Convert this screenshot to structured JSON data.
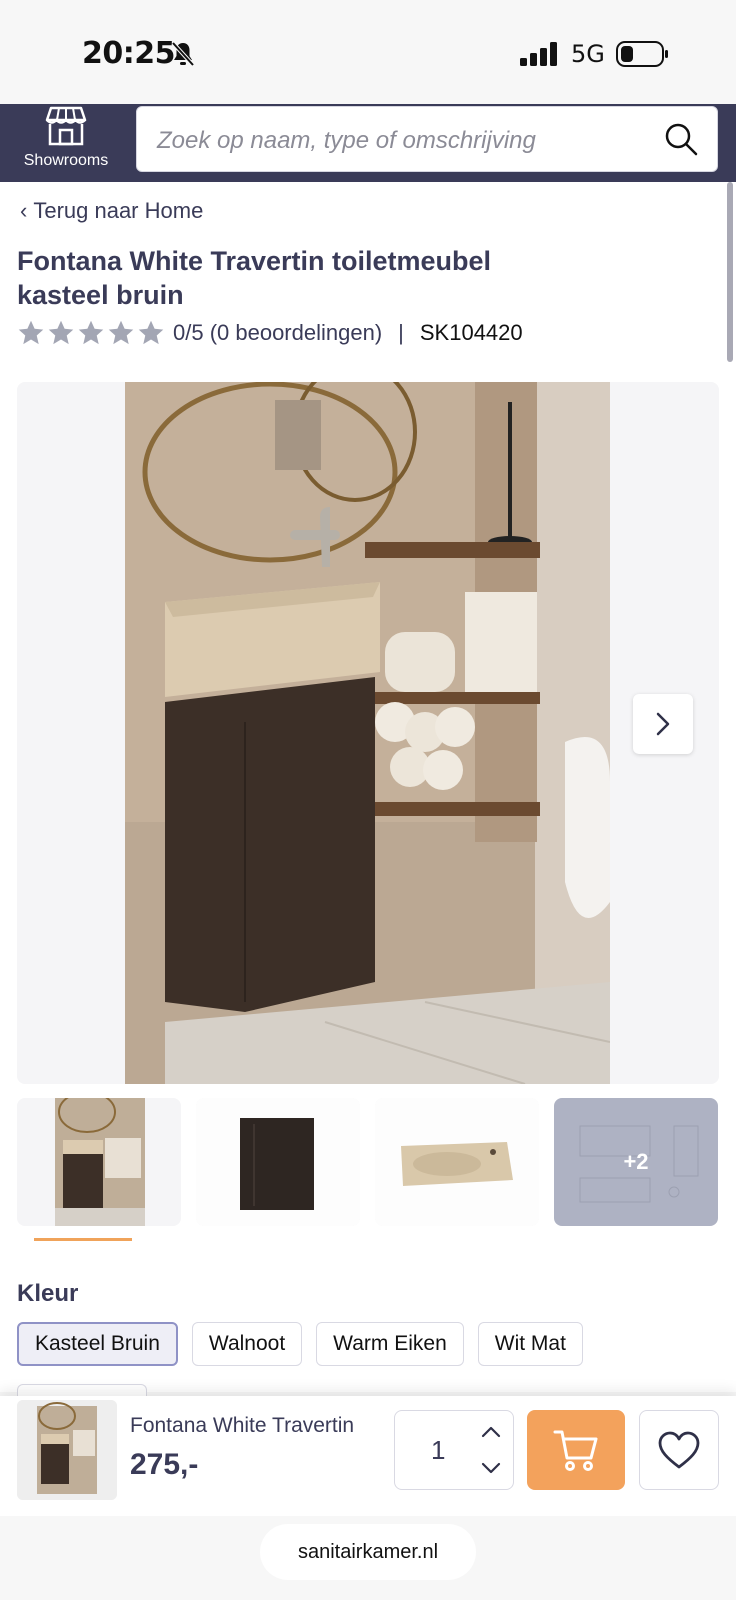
{
  "status_bar": {
    "time": "20:25",
    "network": "5G"
  },
  "header": {
    "showrooms_label": "Showrooms",
    "search_placeholder": "Zoek op naam, type of omschrijving"
  },
  "breadcrumb": {
    "back_label": "Terug naar Home"
  },
  "product": {
    "title": "Fontana White Travertin toiletmeubel kasteel bruin",
    "rating": 0,
    "rating_max": 5,
    "rating_text": "0/5 (0 beoordelingen)",
    "separator": "|",
    "sku": "SK104420"
  },
  "gallery": {
    "thumbnails": [
      "main-photo",
      "cabinet",
      "washbasin",
      "technical-drawing"
    ],
    "more_count_label": "+2"
  },
  "color": {
    "heading": "Kleur",
    "options": [
      "Kasteel Bruin",
      "Walnoot",
      "Warm Eiken",
      "Wit Mat"
    ],
    "selected": "Kasteel Bruin"
  },
  "sticky_bar": {
    "product_name": "Fontana White Travertin",
    "price": "275,-",
    "quantity": "1"
  },
  "browser": {
    "url": "sanitairkamer.nl"
  },
  "colors": {
    "header_bg": "#3a3b58",
    "cart_button": "#f3a25c",
    "thumb_indicator": "#f0a35a",
    "chip_selected_border": "#8f92c6"
  }
}
